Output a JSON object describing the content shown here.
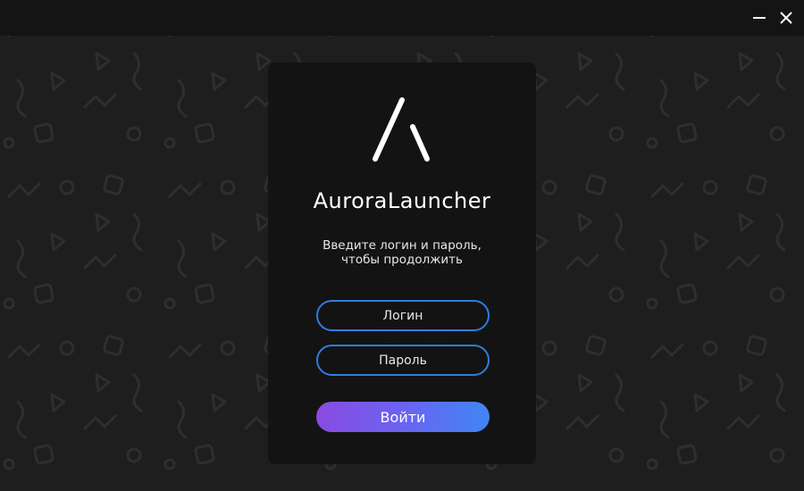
{
  "window": {
    "minimize_icon": "minimize-icon",
    "close_icon": "close-icon"
  },
  "login_card": {
    "logo_icon": "aurora-logo-icon",
    "title": "AuroraLauncher",
    "subtitle_line1": "Введите логин и пароль,",
    "subtitle_line2": "чтобы продолжить",
    "login_placeholder": "Логин",
    "password_placeholder": "Пароль",
    "submit_label": "Войти"
  },
  "colors": {
    "background": "#1e1e1e",
    "titlebar": "#141414",
    "card": "#121212",
    "input_border": "#2f7de1",
    "button_gradient_start": "#8a4be0",
    "button_gradient_end": "#3f86f5",
    "text": "#ffffff"
  }
}
